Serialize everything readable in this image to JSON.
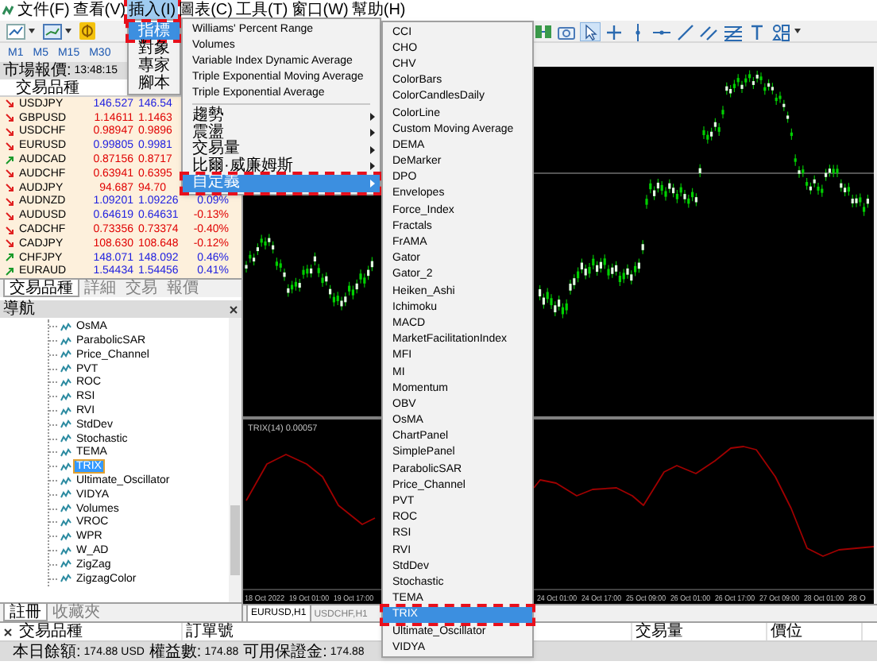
{
  "menu_bar": [
    {
      "label": "文件(F)",
      "selected": false,
      "marked": false
    },
    {
      "label": "查看(V)",
      "selected": false,
      "marked": false
    },
    {
      "label": "插入(I)",
      "selected": true,
      "marked": true
    },
    {
      "label": "圖表(C)",
      "selected": false,
      "marked": false
    },
    {
      "label": "工具(T)",
      "selected": false,
      "marked": false
    },
    {
      "label": "窗口(W)",
      "selected": false,
      "marked": false
    },
    {
      "label": "幫助(H)",
      "selected": false,
      "marked": false
    }
  ],
  "timeframes": [
    "M1",
    "M5",
    "M15",
    "M30"
  ],
  "market_watch": {
    "title": "市場報價:",
    "time": "13:48:15",
    "column": "交易品種",
    "rows": [
      {
        "symbol": "USDJPY",
        "rising": false,
        "bid_up": true,
        "bid": "146.527",
        "ask": "146.54"
      },
      {
        "symbol": "GBPUSD",
        "rising": false,
        "bid_up": false,
        "bid": "1.14611",
        "ask": "1.1463"
      },
      {
        "symbol": "USDCHF",
        "rising": false,
        "bid_up": false,
        "bid": "0.98947",
        "ask": "0.9896"
      },
      {
        "symbol": "EURUSD",
        "rising": false,
        "bid_up": true,
        "bid": "0.99805",
        "ask": "0.9981"
      },
      {
        "symbol": "AUDCAD",
        "rising": true,
        "bid_up": false,
        "bid": "0.87156",
        "ask": "0.8717"
      },
      {
        "symbol": "AUDCHF",
        "rising": false,
        "bid_up": false,
        "bid": "0.63941",
        "ask": "0.6395"
      },
      {
        "symbol": "AUDJPY",
        "rising": false,
        "bid_up": false,
        "bid": "94.687",
        "ask": "94.70"
      },
      {
        "symbol": "AUDNZD",
        "rising": false,
        "bid_up": true,
        "bid": "1.09201",
        "ask": "1.09226",
        "change": "0.09%",
        "change_up": true
      },
      {
        "symbol": "AUDUSD",
        "rising": false,
        "bid_up": true,
        "bid": "0.64619",
        "ask": "0.64631",
        "change": "-0.13%",
        "change_up": false
      },
      {
        "symbol": "CADCHF",
        "rising": false,
        "bid_up": false,
        "bid": "0.73356",
        "ask": "0.73374",
        "change": "-0.40%",
        "change_up": false
      },
      {
        "symbol": "CADJPY",
        "rising": false,
        "bid_up": false,
        "bid": "108.630",
        "ask": "108.648",
        "change": "-0.12%",
        "change_up": false
      },
      {
        "symbol": "CHFJPY",
        "rising": true,
        "bid_up": true,
        "bid": "148.071",
        "ask": "148.092",
        "change": "0.46%",
        "change_up": true
      },
      {
        "symbol": "EURAUD",
        "rising": true,
        "bid_up": true,
        "bid": "1.54434",
        "ask": "1.54456",
        "change": "0.41%",
        "change_up": true
      }
    ]
  },
  "market_watch_tabs": [
    {
      "label": "交易品種",
      "selected": true
    },
    {
      "label": "詳細",
      "selected": false
    },
    {
      "label": "交易",
      "selected": false
    },
    {
      "label": "報價",
      "selected": false
    }
  ],
  "navigator": {
    "title": "導航",
    "items": [
      {
        "label": "OsMA",
        "selected": false
      },
      {
        "label": "ParabolicSAR",
        "selected": false
      },
      {
        "label": "Price_Channel",
        "selected": false
      },
      {
        "label": "PVT",
        "selected": false
      },
      {
        "label": "ROC",
        "selected": false
      },
      {
        "label": "RSI",
        "selected": false
      },
      {
        "label": "RVI",
        "selected": false
      },
      {
        "label": "StdDev",
        "selected": false
      },
      {
        "label": "Stochastic",
        "selected": false
      },
      {
        "label": "TEMA",
        "selected": false
      },
      {
        "label": "TRIX",
        "selected": true
      },
      {
        "label": "Ultimate_Oscillator",
        "selected": false
      },
      {
        "label": "VIDYA",
        "selected": false
      },
      {
        "label": "Volumes",
        "selected": false
      },
      {
        "label": "VROC",
        "selected": false
      },
      {
        "label": "WPR",
        "selected": false
      },
      {
        "label": "W_AD",
        "selected": false
      },
      {
        "label": "ZigZag",
        "selected": false
      },
      {
        "label": "ZigzagColor",
        "selected": false
      }
    ]
  },
  "navigator_tabs": [
    {
      "label": "註冊",
      "selected": true
    },
    {
      "label": "收藏夾",
      "selected": false
    }
  ],
  "chart": {
    "indicator_label": "TRIX(14) 0.00057",
    "time_labels": [
      "18 Oct 2022",
      "19 Oct 01:00",
      "19 Oct 17:00",
      "24 Oct 01:00",
      "24 Oct 17:00",
      "25 Oct 09:00",
      "26 Oct 01:00",
      "26 Oct 17:00",
      "27 Oct 09:00",
      "28 Oct 01:00",
      "28 O"
    ]
  },
  "chart_tabs": [
    {
      "label": "EURUSD,H1",
      "selected": true
    },
    {
      "label": "USDCHF,H1",
      "selected": false
    }
  ],
  "terminal": {
    "columns": [
      "交易品種",
      "訂單號",
      "交易量",
      "價位"
    ],
    "summary": [
      {
        "label": "本日餘額:",
        "value": "174.88 USD"
      },
      {
        "label": "權益數:",
        "value": "174.88"
      },
      {
        "label": "可用保證金:",
        "value": "174.88"
      }
    ]
  },
  "insert_menu": [
    {
      "label": "指標",
      "selected": true,
      "marked": true
    },
    {
      "label": "對象",
      "selected": false,
      "marked": false
    },
    {
      "label": "專家",
      "selected": false,
      "marked": false
    },
    {
      "label": "腳本",
      "selected": false,
      "marked": false
    }
  ],
  "indicators_menu": [
    {
      "kind": "command",
      "label": "Williams' Percent Range",
      "selected": false,
      "marked": false
    },
    {
      "kind": "command",
      "label": "Volumes",
      "selected": false,
      "marked": false
    },
    {
      "kind": "command",
      "label": "Variable Index Dynamic Average",
      "selected": false,
      "marked": false
    },
    {
      "kind": "command",
      "label": "Triple Exponential Moving Average",
      "selected": false,
      "marked": false
    },
    {
      "kind": "command",
      "label": "Triple Exponential Average",
      "selected": false,
      "marked": false
    },
    {
      "kind": "separator"
    },
    {
      "kind": "submenu",
      "label": "趨勢",
      "selected": false,
      "marked": false
    },
    {
      "kind": "submenu",
      "label": "震盪",
      "selected": false,
      "marked": false
    },
    {
      "kind": "submenu",
      "label": "交易量",
      "selected": false,
      "marked": false
    },
    {
      "kind": "submenu",
      "label": "比爾·威廉姆斯",
      "selected": false,
      "marked": false
    },
    {
      "kind": "submenu",
      "label": "自定義",
      "selected": true,
      "marked": true
    }
  ],
  "custom_menu": [
    {
      "label": "CCI",
      "selected": false,
      "marked": false
    },
    {
      "label": "CHO",
      "selected": false,
      "marked": false
    },
    {
      "label": "CHV",
      "selected": false,
      "marked": false
    },
    {
      "label": "ColorBars",
      "selected": false,
      "marked": false
    },
    {
      "label": "ColorCandlesDaily",
      "selected": false,
      "marked": false
    },
    {
      "label": "ColorLine",
      "selected": false,
      "marked": false
    },
    {
      "label": "Custom Moving Average",
      "selected": false,
      "marked": false
    },
    {
      "label": "DEMA",
      "selected": false,
      "marked": false
    },
    {
      "label": "DeMarker",
      "selected": false,
      "marked": false
    },
    {
      "label": "DPO",
      "selected": false,
      "marked": false
    },
    {
      "label": "Envelopes",
      "selected": false,
      "marked": false
    },
    {
      "label": "Force_Index",
      "selected": false,
      "marked": false
    },
    {
      "label": "Fractals",
      "selected": false,
      "marked": false
    },
    {
      "label": "FrAMA",
      "selected": false,
      "marked": false
    },
    {
      "label": "Gator",
      "selected": false,
      "marked": false
    },
    {
      "label": "Gator_2",
      "selected": false,
      "marked": false
    },
    {
      "label": "Heiken_Ashi",
      "selected": false,
      "marked": false
    },
    {
      "label": "Ichimoku",
      "selected": false,
      "marked": false
    },
    {
      "label": "MACD",
      "selected": false,
      "marked": false
    },
    {
      "label": "MarketFacilitationIndex",
      "selected": false,
      "marked": false
    },
    {
      "label": "MFI",
      "selected": false,
      "marked": false
    },
    {
      "label": "MI",
      "selected": false,
      "marked": false
    },
    {
      "label": "Momentum",
      "selected": false,
      "marked": false
    },
    {
      "label": "OBV",
      "selected": false,
      "marked": false
    },
    {
      "label": "OsMA",
      "selected": false,
      "marked": false
    },
    {
      "label": "ChartPanel",
      "selected": false,
      "marked": false
    },
    {
      "label": "SimplePanel",
      "selected": false,
      "marked": false
    },
    {
      "label": "ParabolicSAR",
      "selected": false,
      "marked": false
    },
    {
      "label": "Price_Channel",
      "selected": false,
      "marked": false
    },
    {
      "label": "PVT",
      "selected": false,
      "marked": false
    },
    {
      "label": "ROC",
      "selected": false,
      "marked": false
    },
    {
      "label": "RSI",
      "selected": false,
      "marked": false
    },
    {
      "label": "RVI",
      "selected": false,
      "marked": false
    },
    {
      "label": "StdDev",
      "selected": false,
      "marked": false
    },
    {
      "label": "Stochastic",
      "selected": false,
      "marked": false
    },
    {
      "label": "TEMA",
      "selected": false,
      "marked": false
    },
    {
      "label": "TRIX",
      "selected": true,
      "marked": true
    },
    {
      "label": "Ultimate_Oscillator",
      "selected": false,
      "marked": false
    },
    {
      "label": "VIDYA",
      "selected": false,
      "marked": false
    }
  ]
}
